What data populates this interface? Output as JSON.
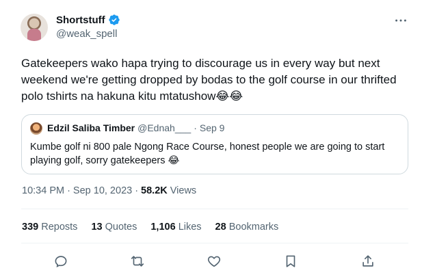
{
  "author": {
    "display_name": "Shortstuff",
    "handle": "@weak_spell",
    "verified_icon": "verified-badge-icon",
    "avatar_icon": "profile-photo"
  },
  "tweet": {
    "text": "Gatekeepers wako hapa trying to discourage us in every way but next weekend we're getting dropped by bodas to the golf course in our thrifted polo tshirts na hakuna kitu mtatushow😂😂"
  },
  "quote": {
    "display_name": "Edzil Saliba Timber",
    "handle": "@Ednah___",
    "separator": "·",
    "date": "Sep 9",
    "text": "Kumbe golf ni 800 pale Ngong Race Course, honest people we are going to start playing golf, sorry gatekeepers 😂"
  },
  "meta": {
    "time": "10:34 PM",
    "date": "Sep 10, 2023",
    "separator": "·",
    "views_count": "58.2K",
    "views_label": "Views"
  },
  "stats": {
    "reposts_count": "339",
    "reposts_label": "Reposts",
    "quotes_count": "13",
    "quotes_label": "Quotes",
    "likes_count": "1,106",
    "likes_label": "Likes",
    "bookmarks_count": "28",
    "bookmarks_label": "Bookmarks"
  },
  "actions": [
    "reply-icon",
    "repost-icon",
    "like-icon",
    "bookmark-icon",
    "share-icon"
  ],
  "colors": {
    "text": "#0f1419",
    "secondary": "#536471",
    "verified": "#1d9bf0",
    "border": "#cfd9de"
  }
}
